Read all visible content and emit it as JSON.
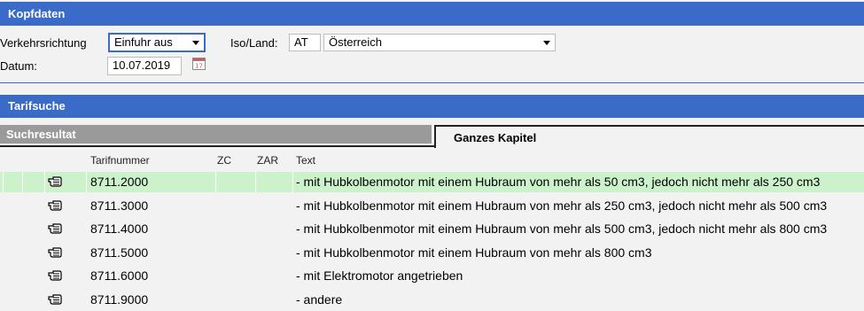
{
  "kopfdaten": {
    "title": "Kopfdaten",
    "verkehrsrichtung_label": "Verkehrsrichtung",
    "verkehrsrichtung_value": "Einfuhr aus",
    "iso_land_label": "Iso/Land:",
    "iso_code": "AT",
    "land_value": "Österreich",
    "datum_label": "Datum:",
    "datum_value": "10.07.2019",
    "calendar_icon": "calendar-icon"
  },
  "tarifsuche": {
    "title": "Tarifsuche"
  },
  "tabs": {
    "suchresultat": "Suchresultat",
    "ganzes_kapitel": "Ganzes Kapitel"
  },
  "table": {
    "headers": {
      "tarifnummer": "Tarifnummer",
      "zc": "ZC",
      "zar": "ZAR",
      "text": "Text"
    },
    "row_icon": "hand-pointer-icon",
    "rows": [
      {
        "tarifnummer": "8711.2000",
        "text": "-  mit Hubkolbenmotor mit einem Hubraum von mehr als 50 cm3, jedoch nicht mehr als 250 cm3",
        "selected": true
      },
      {
        "tarifnummer": "8711.3000",
        "text": "-  mit Hubkolbenmotor mit einem Hubraum von mehr als 250 cm3, jedoch nicht mehr als 500 cm3",
        "selected": false
      },
      {
        "tarifnummer": "8711.4000",
        "text": "-  mit Hubkolbenmotor mit einem Hubraum von mehr als 500 cm3, jedoch nicht mehr als 800 cm3",
        "selected": false
      },
      {
        "tarifnummer": "8711.5000",
        "text": "-  mit Hubkolbenmotor mit einem Hubraum von mehr als 800 cm3",
        "selected": false
      },
      {
        "tarifnummer": "8711.6000",
        "text": "-  mit Elektromotor angetrieben",
        "selected": false
      },
      {
        "tarifnummer": "8711.9000",
        "text": "-  andere",
        "selected": false
      }
    ]
  },
  "colors": {
    "header_blue": "#3a6bc8",
    "selected_row": "#ccf2cc",
    "inactive_tab": "#9a9a9a"
  }
}
